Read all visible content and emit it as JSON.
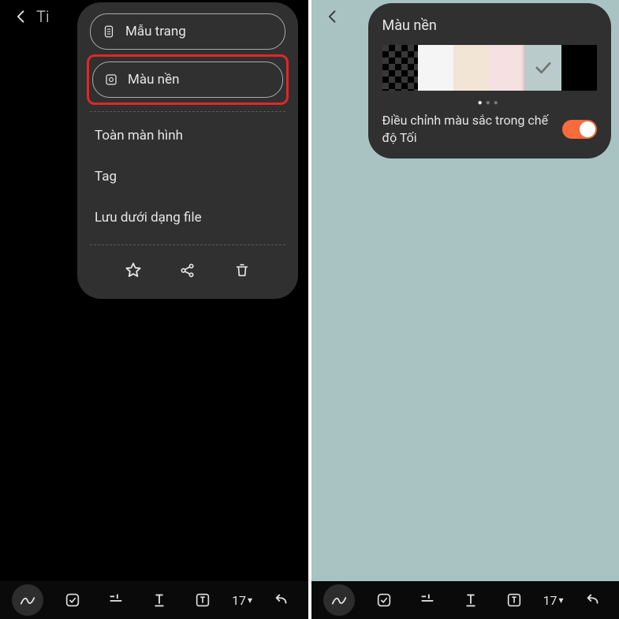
{
  "left": {
    "title": "Ti",
    "menu": {
      "template": "Mẫu trang",
      "background": "Màu nền",
      "fullscreen": "Toàn màn hình",
      "tag": "Tag",
      "savefile": "Lưu dưới dạng file"
    },
    "toolbar_font_size": "17"
  },
  "right": {
    "panel_title": "Màu nền",
    "swatches": [
      {
        "id": "transparent",
        "type": "checker"
      },
      {
        "id": "white",
        "color": "#f5f5f5"
      },
      {
        "id": "cream",
        "color": "#f2e5d6"
      },
      {
        "id": "pink",
        "color": "#f6e1e2"
      },
      {
        "id": "teal",
        "color": "#b9cccb",
        "selected": true
      },
      {
        "id": "black",
        "color": "#000000"
      }
    ],
    "darkmode_label": "Điều chỉnh màu sắc trong chế độ Tối",
    "darkmode_on": true,
    "toolbar_font_size": "17"
  }
}
